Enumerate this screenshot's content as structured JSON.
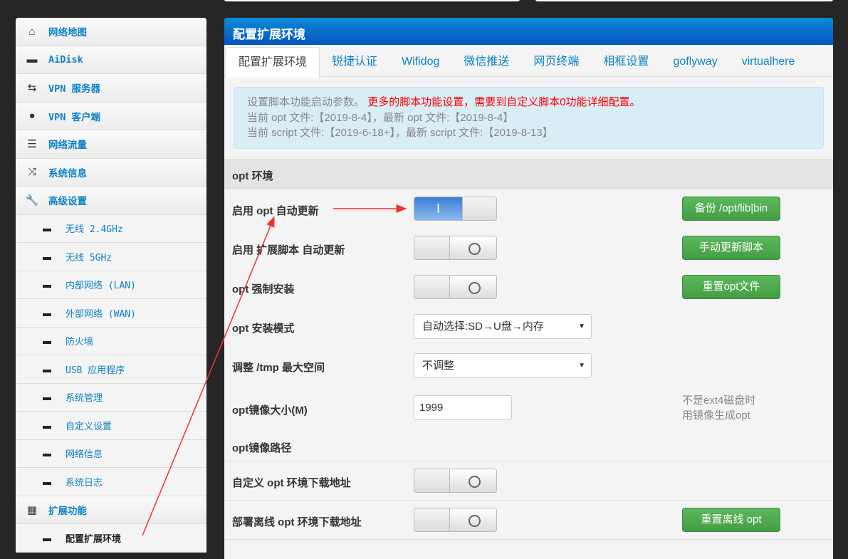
{
  "sidebar": {
    "items": [
      {
        "icon": "home-icon",
        "glyph": "⌂",
        "label": "网络地图"
      },
      {
        "icon": "hdd-icon",
        "glyph": "▬",
        "label": "AiDisk"
      },
      {
        "icon": "retweet-icon",
        "glyph": "⇆",
        "label": "VPN 服务器"
      },
      {
        "icon": "globe-icon",
        "glyph": "●",
        "label": "VPN 客户端"
      },
      {
        "icon": "tasks-icon",
        "glyph": "☰",
        "label": "网络流量"
      },
      {
        "icon": "random-icon",
        "glyph": "⤨",
        "label": "系统信息"
      },
      {
        "icon": "wrench-icon",
        "glyph": "🔧",
        "label": "高级设置"
      }
    ],
    "sub_items": [
      "无线 2.4GHz",
      "无线 5GHz",
      "内部网络 (LAN)",
      "外部网络 (WAN)",
      "防火墙",
      "USB 应用程序",
      "系统管理",
      "自定义设置",
      "网络信息",
      "系统日志"
    ],
    "ext": {
      "icon": "grid-icon",
      "glyph": "▦",
      "label": "扩展功能"
    },
    "ext_sub": "配置扩展环境"
  },
  "main": {
    "title": "配置扩展环境",
    "tabs": [
      "配置扩展环境",
      "锐捷认证",
      "Wifidog",
      "微信推送",
      "网页终端",
      "相框设置",
      "goflyway",
      "virtualhere"
    ],
    "alert": {
      "line1": "设置脚本功能启动参数。",
      "line1_red": "更多的脚本功能设置，需要到自定义脚本0功能详细配置。",
      "line2": "当前 opt 文件:【2019-8-4】，最新 opt 文件:【2019-8-4】",
      "line3": "当前 script 文件:【2019-6-18+】，最新 script 文件:【2019-8-13】"
    },
    "section": "opt 环境",
    "rows": {
      "auto_update": {
        "label": "启用 opt 自动更新",
        "state": "on",
        "on_glyph": "I",
        "button": "备份 /opt/lib|bin"
      },
      "script_update": {
        "label": "启用 扩展脚本 自动更新",
        "state": "off",
        "button": "手动更新脚本"
      },
      "force_install": {
        "label": "opt 强制安装",
        "state": "off",
        "button": "重置opt文件"
      },
      "install_mode": {
        "label": "opt 安装模式",
        "value": "自动选择:SD→U盘→内存"
      },
      "tmp_size": {
        "label": "调整 /tmp 最大空间",
        "value": "不调整"
      },
      "image_size": {
        "label": "opt镜像大小(M)",
        "value": "1999",
        "note1": "不是ext4磁盘时",
        "note2": "用镜像生成opt"
      },
      "image_path": {
        "label": "opt镜像路径"
      },
      "custom_url": {
        "label": "自定义 opt 环境下载地址",
        "state": "off"
      },
      "offline": {
        "label": "部署离线 opt 环境下载地址",
        "state": "off",
        "button": "重置离线 opt"
      }
    }
  },
  "colors": {
    "accent": "#0d82c8",
    "header": "#0455c0",
    "button": "#5cb85c",
    "annotation": "#f03030"
  }
}
